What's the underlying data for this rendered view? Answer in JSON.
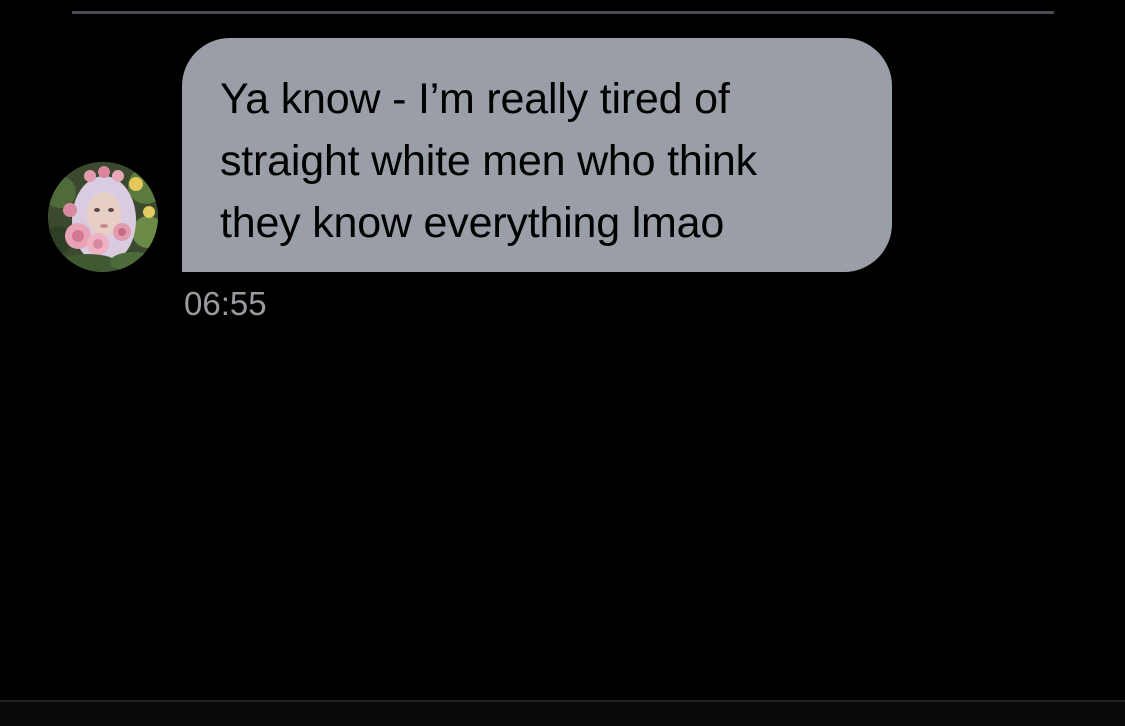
{
  "conversation": {
    "message": {
      "text": "Ya know - I’m really tired of\nstraight white men who think\nthey know everything lmao",
      "timestamp": "06:55"
    }
  },
  "avatar": {
    "icon": "profile-photo-avatar-icon"
  },
  "colors": {
    "background": "#000000",
    "bubble": "#999ea7",
    "bubble_text": "#000000",
    "timestamp": "#9a9ba1",
    "divider": "#4a4a50"
  }
}
